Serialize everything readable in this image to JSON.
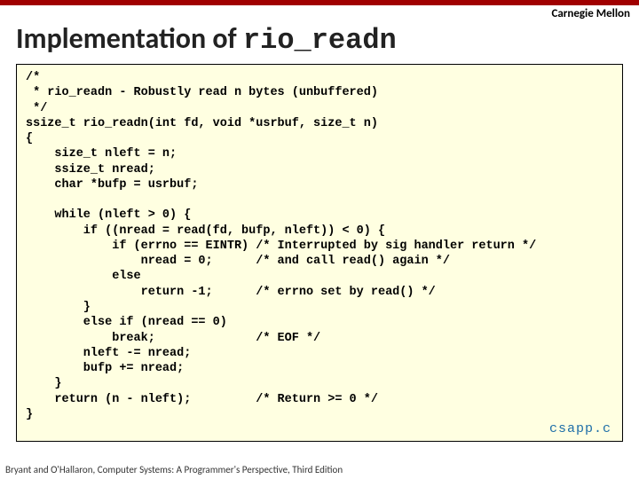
{
  "university": "Carnegie Mellon",
  "title_prefix": "Implementation of ",
  "title_code": "rio_readn",
  "code": "/*\n * rio_readn - Robustly read n bytes (unbuffered)\n */\nssize_t rio_readn(int fd, void *usrbuf, size_t n)\n{\n    size_t nleft = n;\n    ssize_t nread;\n    char *bufp = usrbuf;\n\n    while (nleft > 0) {\n        if ((nread = read(fd, bufp, nleft)) < 0) {\n            if (errno == EINTR) /* Interrupted by sig handler return */\n                nread = 0;      /* and call read() again */\n            else\n                return -1;      /* errno set by read() */\n        }\n        else if (nread == 0)\n            break;              /* EOF */\n        nleft -= nread;\n        bufp += nread;\n    }\n    return (n - nleft);         /* Return >= 0 */\n}",
  "source_file": "csapp.c",
  "footer": "Bryant and O'Hallaron, Computer Systems: A Programmer's Perspective, Third Edition"
}
